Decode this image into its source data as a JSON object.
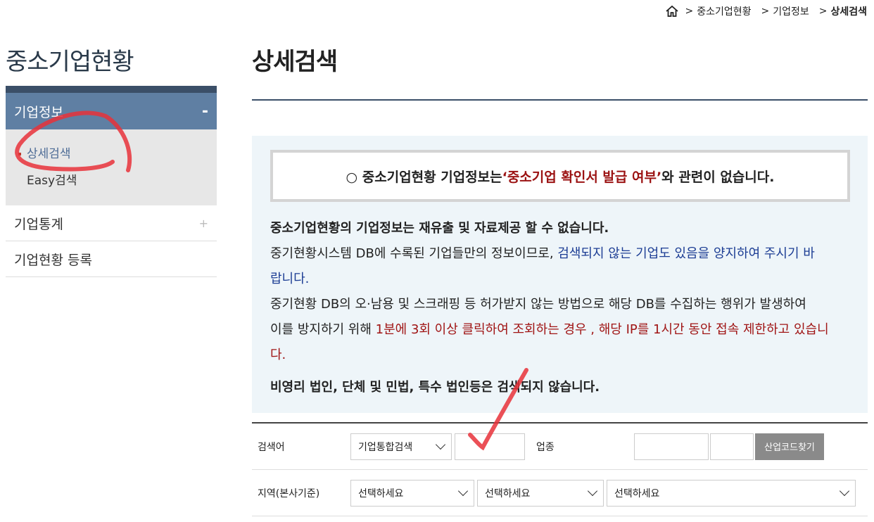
{
  "breadcrumb": {
    "items": [
      "중소기업현황",
      "기업정보",
      "상세검색"
    ]
  },
  "sidebar": {
    "title": "중소기업현황",
    "active_section": "기업정보",
    "active_toggle": "-",
    "sub_items": [
      "상세검색",
      "Easy검색"
    ],
    "rows": [
      {
        "label": "기업통계",
        "toggle": "+"
      },
      {
        "label": "기업현황 등록",
        "toggle": ""
      }
    ]
  },
  "main": {
    "title": "상세검색"
  },
  "notice": {
    "headline_prefix": "○ 중소기업현황 기업정보는 ",
    "headline_highlight": "‘중소기업 확인서 발급 여부’",
    "headline_suffix": "와 관련이 없습니다.",
    "line1": "중소기업현황의 기업정보는 재유출 및 자료제공 할 수 없습니다.",
    "line2_prefix": "중기현황시스템 DB에 수록된 기업들만의 정보이므로, ",
    "line2_blue": "검색되지 않는 기업도 있음을 양지하여 주시기 바",
    "line2_blue_cont": "랍니다.",
    "line3": "중기현황 DB의 오·남용 및 스크래핑 등 허가받지 않는 방법으로 해당 DB를 수집하는 행위가 발생하여",
    "line4_prefix": "이를 방지하기 위해 ",
    "line4_red": "1분에 3회 이상 클릭하여 조회하는 경우 , 해당 IP를 1시간 동안 접속 제한하고 있습니",
    "line4_red_cont": "다.",
    "line5": "비영리 법인, 단체 및 민법, 특수 법인등은 검색되지 않습니다."
  },
  "search_form": {
    "keyword_label": "검색어",
    "keyword_type": "기업통합검색",
    "keyword_value": "",
    "industry_label": "업종",
    "industry_code_button": "산업코드찾기",
    "region_label": "지역(본사기준)",
    "region_selects": [
      "선택하세요",
      "선택하세요",
      "선택하세요"
    ]
  },
  "colors": {
    "sidebar_active": "#5f7fa3",
    "sidebar_top": "#3b4f68",
    "notice_bg": "#eef5f9",
    "highlight_red": "#9b1212",
    "highlight_blue": "#1c3d94",
    "annotation_pen": "#e8313a"
  }
}
